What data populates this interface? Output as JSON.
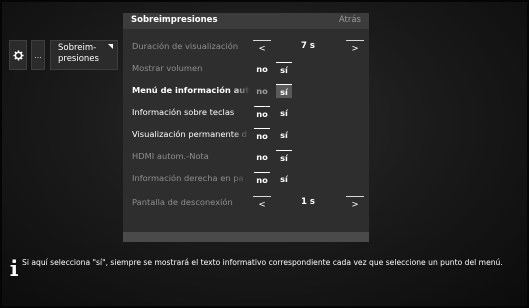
{
  "nav": {
    "gear_icon": "gear-icon",
    "more_label": "...",
    "category_label": "Sobreim-\npresiones"
  },
  "panel": {
    "title": "Sobreimpresiones",
    "back_label": "Atrás",
    "rows": [
      {
        "label": "Duración de visualización",
        "type": "stepper",
        "value": "7 s",
        "prev": "<",
        "next": ">"
      },
      {
        "label": "Mostrar volumen",
        "type": "toggle",
        "no": "no",
        "si": "sí",
        "selected": "si"
      },
      {
        "label": "Menú de información autom",
        "type": "toggle",
        "no": "no",
        "si": "sí",
        "selected": "si",
        "focused": true
      },
      {
        "label": "Información sobre teclas",
        "type": "toggle",
        "no": "no",
        "si": "sí",
        "selected": "no"
      },
      {
        "label": "Visualización permanente d",
        "type": "toggle",
        "no": "no",
        "si": "sí",
        "selected": "no"
      },
      {
        "label": "HDMI autom.-Nota",
        "type": "toggle",
        "no": "no",
        "si": "sí",
        "selected": "si"
      },
      {
        "label": "Información derecha en pa",
        "type": "toggle",
        "no": "no",
        "si": "sí",
        "selected": "no"
      },
      {
        "label": "Pantalla de desconexión",
        "type": "stepper",
        "value": "1 s",
        "prev": "<",
        "next": ">"
      }
    ]
  },
  "info": {
    "icon": "info-icon",
    "text": "Si aquí selecciona \"sí\", siempre se mostrará el texto informativo correspondiente cada vez que seleccione un punto del menú."
  }
}
